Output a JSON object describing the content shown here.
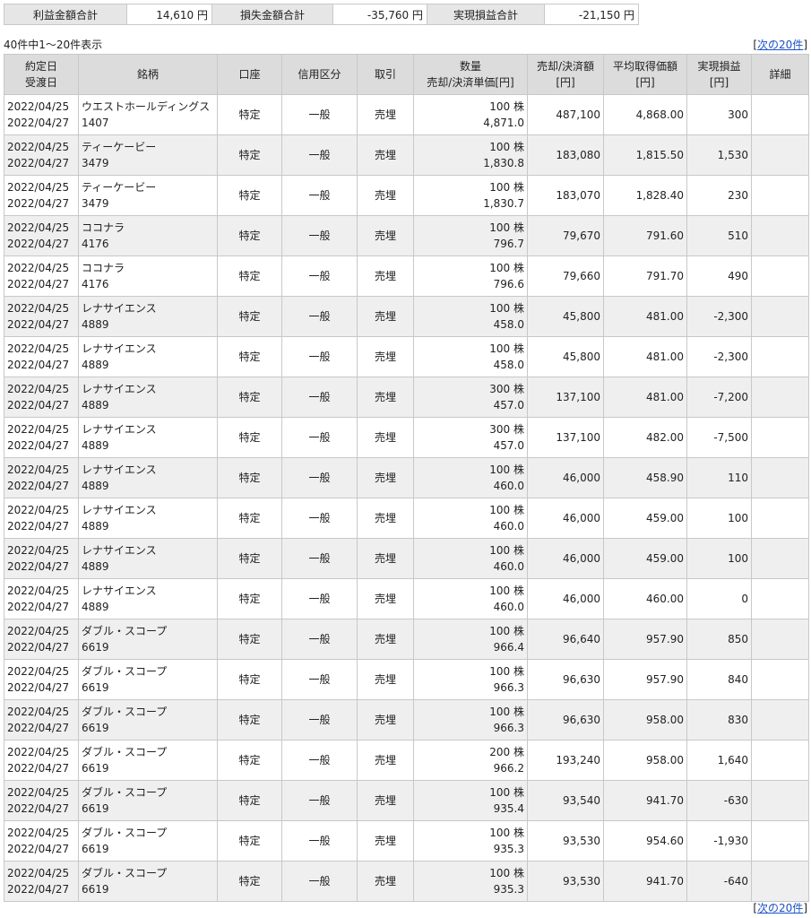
{
  "summary": {
    "profit_label": "利益金額合計",
    "profit_value": "14,610 円",
    "loss_label": "損失金額合計",
    "loss_value": "-35,760 円",
    "realized_label": "実現損益合計",
    "realized_value": "-21,150 円"
  },
  "pagination": {
    "count_text": "40件中1～20件表示",
    "bracket_open": "[",
    "next_label": "次の20件",
    "bracket_close": "]"
  },
  "headers": {
    "contract_date": "約定日",
    "delivery_date": "受渡日",
    "issue": "銘柄",
    "account": "口座",
    "credit": "信用区分",
    "trade": "取引",
    "qty": "数量",
    "unit_price": "売却/決済単価[円]",
    "amount": "売却/決済額",
    "amount_unit": "[円]",
    "avg_cost": "平均取得価額",
    "avg_unit": "[円]",
    "pnl": "実現損益",
    "pnl_unit": "[円]",
    "detail": "詳細"
  },
  "rows": [
    {
      "contract": "2022/04/25",
      "delivery": "2022/04/27",
      "name": "ウエストホールディングス",
      "code": "1407",
      "account": "特定",
      "credit": "一般",
      "trade": "売埋",
      "qty": "100 株",
      "price": "4,871.0",
      "amount": "487,100",
      "avg": "4,868.00",
      "pnl": "300"
    },
    {
      "contract": "2022/04/25",
      "delivery": "2022/04/27",
      "name": "ティーケービー",
      "code": "3479",
      "account": "特定",
      "credit": "一般",
      "trade": "売埋",
      "qty": "100 株",
      "price": "1,830.8",
      "amount": "183,080",
      "avg": "1,815.50",
      "pnl": "1,530"
    },
    {
      "contract": "2022/04/25",
      "delivery": "2022/04/27",
      "name": "ティーケービー",
      "code": "3479",
      "account": "特定",
      "credit": "一般",
      "trade": "売埋",
      "qty": "100 株",
      "price": "1,830.7",
      "amount": "183,070",
      "avg": "1,828.40",
      "pnl": "230"
    },
    {
      "contract": "2022/04/25",
      "delivery": "2022/04/27",
      "name": "ココナラ",
      "code": "4176",
      "account": "特定",
      "credit": "一般",
      "trade": "売埋",
      "qty": "100 株",
      "price": "796.7",
      "amount": "79,670",
      "avg": "791.60",
      "pnl": "510"
    },
    {
      "contract": "2022/04/25",
      "delivery": "2022/04/27",
      "name": "ココナラ",
      "code": "4176",
      "account": "特定",
      "credit": "一般",
      "trade": "売埋",
      "qty": "100 株",
      "price": "796.6",
      "amount": "79,660",
      "avg": "791.70",
      "pnl": "490"
    },
    {
      "contract": "2022/04/25",
      "delivery": "2022/04/27",
      "name": "レナサイエンス",
      "code": "4889",
      "account": "特定",
      "credit": "一般",
      "trade": "売埋",
      "qty": "100 株",
      "price": "458.0",
      "amount": "45,800",
      "avg": "481.00",
      "pnl": "-2,300"
    },
    {
      "contract": "2022/04/25",
      "delivery": "2022/04/27",
      "name": "レナサイエンス",
      "code": "4889",
      "account": "特定",
      "credit": "一般",
      "trade": "売埋",
      "qty": "100 株",
      "price": "458.0",
      "amount": "45,800",
      "avg": "481.00",
      "pnl": "-2,300"
    },
    {
      "contract": "2022/04/25",
      "delivery": "2022/04/27",
      "name": "レナサイエンス",
      "code": "4889",
      "account": "特定",
      "credit": "一般",
      "trade": "売埋",
      "qty": "300 株",
      "price": "457.0",
      "amount": "137,100",
      "avg": "481.00",
      "pnl": "-7,200"
    },
    {
      "contract": "2022/04/25",
      "delivery": "2022/04/27",
      "name": "レナサイエンス",
      "code": "4889",
      "account": "特定",
      "credit": "一般",
      "trade": "売埋",
      "qty": "300 株",
      "price": "457.0",
      "amount": "137,100",
      "avg": "482.00",
      "pnl": "-7,500"
    },
    {
      "contract": "2022/04/25",
      "delivery": "2022/04/27",
      "name": "レナサイエンス",
      "code": "4889",
      "account": "特定",
      "credit": "一般",
      "trade": "売埋",
      "qty": "100 株",
      "price": "460.0",
      "amount": "46,000",
      "avg": "458.90",
      "pnl": "110"
    },
    {
      "contract": "2022/04/25",
      "delivery": "2022/04/27",
      "name": "レナサイエンス",
      "code": "4889",
      "account": "特定",
      "credit": "一般",
      "trade": "売埋",
      "qty": "100 株",
      "price": "460.0",
      "amount": "46,000",
      "avg": "459.00",
      "pnl": "100"
    },
    {
      "contract": "2022/04/25",
      "delivery": "2022/04/27",
      "name": "レナサイエンス",
      "code": "4889",
      "account": "特定",
      "credit": "一般",
      "trade": "売埋",
      "qty": "100 株",
      "price": "460.0",
      "amount": "46,000",
      "avg": "459.00",
      "pnl": "100"
    },
    {
      "contract": "2022/04/25",
      "delivery": "2022/04/27",
      "name": "レナサイエンス",
      "code": "4889",
      "account": "特定",
      "credit": "一般",
      "trade": "売埋",
      "qty": "100 株",
      "price": "460.0",
      "amount": "46,000",
      "avg": "460.00",
      "pnl": "0"
    },
    {
      "contract": "2022/04/25",
      "delivery": "2022/04/27",
      "name": "ダブル・スコープ",
      "code": "6619",
      "account": "特定",
      "credit": "一般",
      "trade": "売埋",
      "qty": "100 株",
      "price": "966.4",
      "amount": "96,640",
      "avg": "957.90",
      "pnl": "850"
    },
    {
      "contract": "2022/04/25",
      "delivery": "2022/04/27",
      "name": "ダブル・スコープ",
      "code": "6619",
      "account": "特定",
      "credit": "一般",
      "trade": "売埋",
      "qty": "100 株",
      "price": "966.3",
      "amount": "96,630",
      "avg": "957.90",
      "pnl": "840"
    },
    {
      "contract": "2022/04/25",
      "delivery": "2022/04/27",
      "name": "ダブル・スコープ",
      "code": "6619",
      "account": "特定",
      "credit": "一般",
      "trade": "売埋",
      "qty": "100 株",
      "price": "966.3",
      "amount": "96,630",
      "avg": "958.00",
      "pnl": "830"
    },
    {
      "contract": "2022/04/25",
      "delivery": "2022/04/27",
      "name": "ダブル・スコープ",
      "code": "6619",
      "account": "特定",
      "credit": "一般",
      "trade": "売埋",
      "qty": "200 株",
      "price": "966.2",
      "amount": "193,240",
      "avg": "958.00",
      "pnl": "1,640"
    },
    {
      "contract": "2022/04/25",
      "delivery": "2022/04/27",
      "name": "ダブル・スコープ",
      "code": "6619",
      "account": "特定",
      "credit": "一般",
      "trade": "売埋",
      "qty": "100 株",
      "price": "935.4",
      "amount": "93,540",
      "avg": "941.70",
      "pnl": "-630"
    },
    {
      "contract": "2022/04/25",
      "delivery": "2022/04/27",
      "name": "ダブル・スコープ",
      "code": "6619",
      "account": "特定",
      "credit": "一般",
      "trade": "売埋",
      "qty": "100 株",
      "price": "935.3",
      "amount": "93,530",
      "avg": "954.60",
      "pnl": "-1,930"
    },
    {
      "contract": "2022/04/25",
      "delivery": "2022/04/27",
      "name": "ダブル・スコープ",
      "code": "6619",
      "account": "特定",
      "credit": "一般",
      "trade": "売埋",
      "qty": "100 株",
      "price": "935.3",
      "amount": "93,530",
      "avg": "941.70",
      "pnl": "-640"
    }
  ]
}
